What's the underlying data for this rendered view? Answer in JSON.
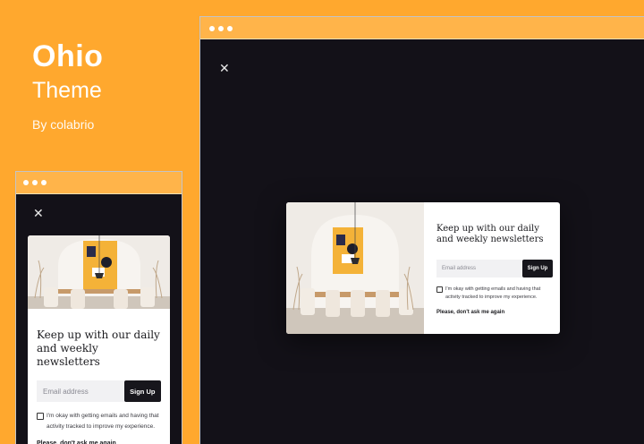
{
  "brand": {
    "title": "Ohio",
    "subtitle": "Theme",
    "byline": "By colabrio"
  },
  "popup": {
    "close_icon": "close-icon",
    "heading": "Keep up with our daily and weekly newsletters",
    "email_placeholder": "Email address",
    "signup_label": "Sign Up",
    "consent_text": "I'm okay with getting emails and having that activity tracked to improve my experience.",
    "decline_label": "Please, don't ask me again"
  },
  "colors": {
    "accent": "#ffa82e",
    "window_bg": "#131118",
    "button_bg": "#17161c"
  }
}
